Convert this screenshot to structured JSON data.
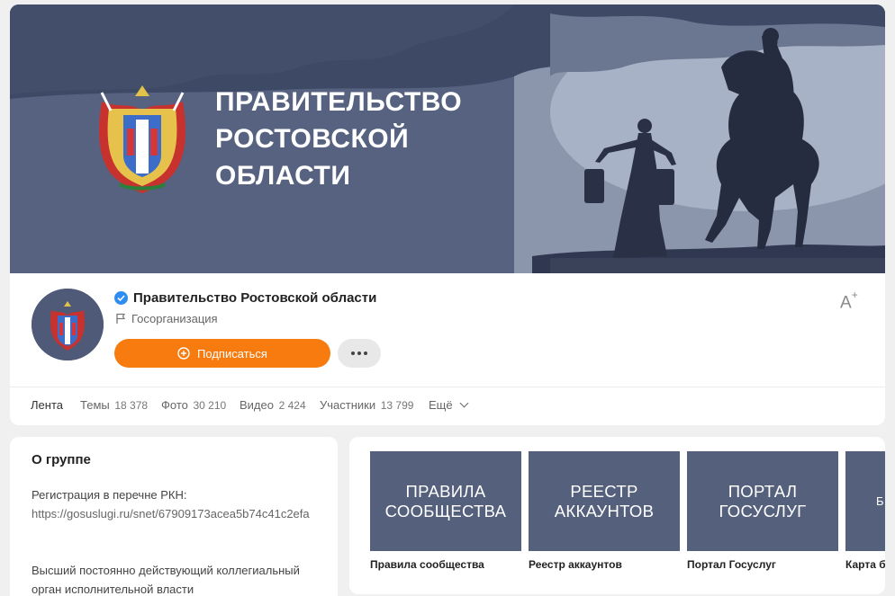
{
  "colors": {
    "accent": "#f77b0f",
    "verified": "#2d8df0",
    "tile_bg": "#55607d",
    "cover_bg": "#4e5a78"
  },
  "cover": {
    "title_lines": [
      "ПРАВИТЕЛЬСТВО",
      "РОСТОВСКОЙ",
      "ОБЛАСТИ"
    ]
  },
  "group": {
    "name": "Правительство Ростовской области",
    "type": "Госорганизация",
    "subscribe_label": "Подписаться",
    "verified_icon": "verified-check-icon",
    "font_size_icon": "font-size-icon"
  },
  "tabs": [
    {
      "label": "Лента",
      "count": ""
    },
    {
      "label": "Темы",
      "count": "18 378"
    },
    {
      "label": "Фото",
      "count": "30 210"
    },
    {
      "label": "Видео",
      "count": "2 424"
    },
    {
      "label": "Участники",
      "count": "13 799"
    },
    {
      "label": "Ещё",
      "count": ""
    }
  ],
  "about": {
    "title": "О группе",
    "registration_label": "Регистрация в перечне РКН:",
    "registration_link": "https://gosuslugi.ru/snet/67909173acea5b74c41c2efa",
    "description": "Высший постоянно действующий коллегиальный орган исполнительной власти"
  },
  "links": [
    {
      "tile": "ПРАВИЛА\nСООБЩЕСТВА",
      "caption": "Правила сообщества"
    },
    {
      "tile": "РЕЕСТР\nАККАУНТОВ",
      "caption": "Реестр аккаунтов"
    },
    {
      "tile": "ПОРТАЛ\nГОСУСЛУГ",
      "caption": "Портал Госуслуг"
    },
    {
      "tile": "Б",
      "caption": "Карта б"
    }
  ]
}
